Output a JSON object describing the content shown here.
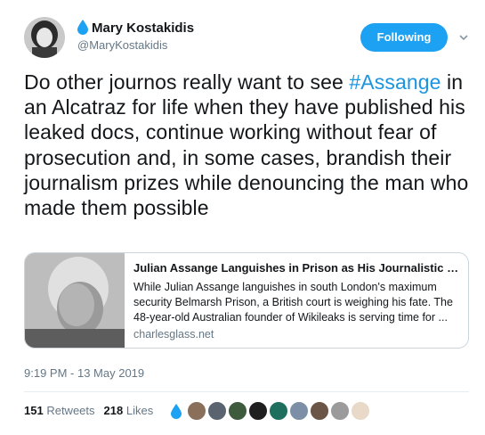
{
  "author": {
    "display_name": "Mary Kostakidis",
    "handle": "@MaryKostakidis",
    "emoji_icon": "water-drop-icon"
  },
  "follow_button": {
    "label": "Following",
    "color": "#1da1f2"
  },
  "menu_icon": "chevron-down-icon",
  "tweet": {
    "text_before": "Do other journos really want to see ",
    "hashtag": "#Assange",
    "text_after": " in an Alcatraz for life when they have published his leaked docs, continue working without fear of prosecution and, in some cases, brandish their journalism prizes while denouncing the man who made them possible",
    "hashtag_color": "#1b95e0"
  },
  "card": {
    "title": "Julian Assange Languishes in Prison as His Journalistic C...",
    "description": "While Julian Assange languishes in south London's maximum security Belmarsh Prison, a British court is weighing his fate. The 48-year-old Australian founder of Wikileaks is serving time for ...",
    "domain": "charlesglass.net"
  },
  "timestamp": "9:19 PM - 13 May 2019",
  "stats": {
    "retweets_count": "151",
    "retweets_label": "Retweets",
    "likes_count": "218",
    "likes_label": "Likes"
  },
  "likers": [
    {
      "name": "liker-avatar-drop",
      "color": "#1da1f2"
    },
    {
      "name": "liker-avatar-1",
      "color": "#8a6f5a"
    },
    {
      "name": "liker-avatar-2",
      "color": "#5a6470"
    },
    {
      "name": "liker-avatar-3",
      "color": "#3e5b3e"
    },
    {
      "name": "liker-avatar-4",
      "color": "#1f1f1f"
    },
    {
      "name": "liker-avatar-5",
      "color": "#1f6f5f"
    },
    {
      "name": "liker-avatar-6",
      "color": "#7d8fa6"
    },
    {
      "name": "liker-avatar-7",
      "color": "#6b5547"
    },
    {
      "name": "liker-avatar-8",
      "color": "#9b9b9b"
    },
    {
      "name": "liker-avatar-9",
      "color": "#e8d9c8"
    }
  ],
  "colors": {
    "secondary_text": "#657786",
    "border": "#ccd6dd"
  }
}
